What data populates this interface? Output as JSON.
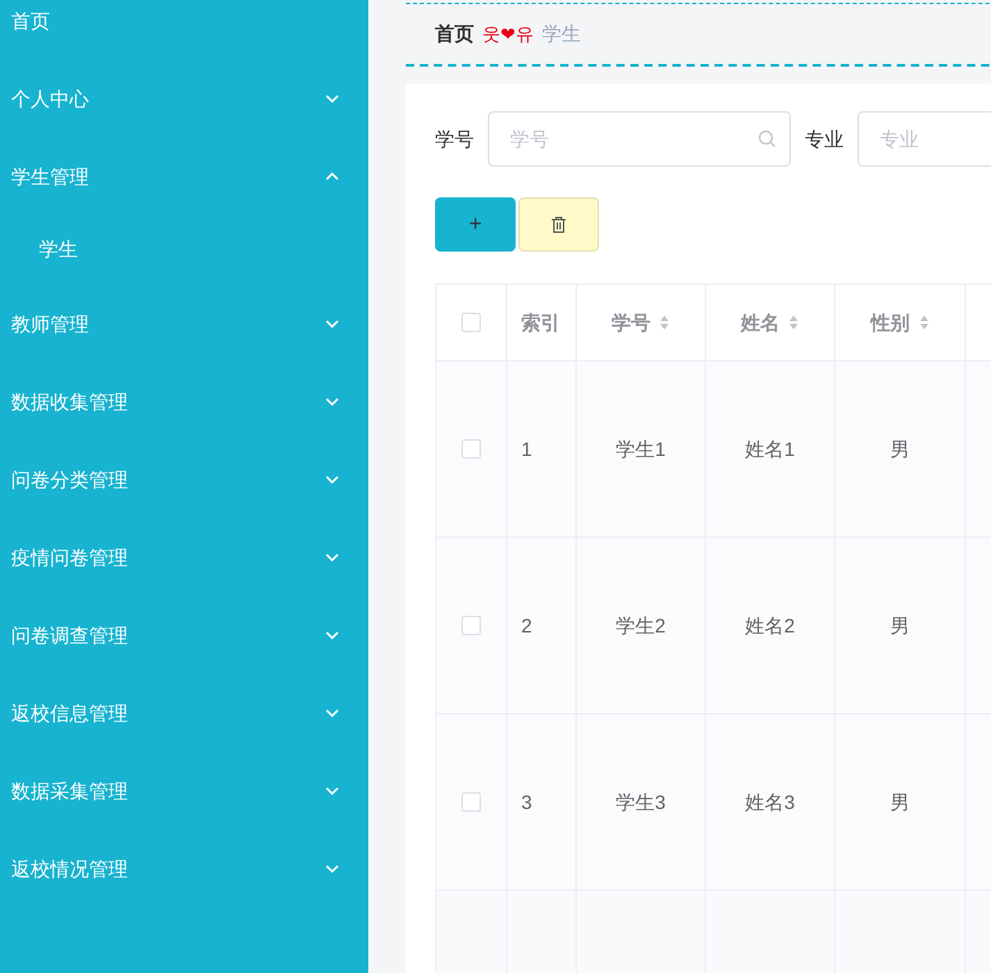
{
  "sidebar": {
    "items": [
      {
        "label": "首页",
        "has_children": false
      },
      {
        "label": "个人中心",
        "has_children": true,
        "expanded": false
      },
      {
        "label": "学生管理",
        "has_children": true,
        "expanded": true,
        "children": [
          {
            "label": "学生"
          }
        ]
      },
      {
        "label": "教师管理",
        "has_children": true,
        "expanded": false
      },
      {
        "label": "数据收集管理",
        "has_children": true,
        "expanded": false
      },
      {
        "label": "问卷分类管理",
        "has_children": true,
        "expanded": false
      },
      {
        "label": "疫情问卷管理",
        "has_children": true,
        "expanded": false
      },
      {
        "label": "问卷调查管理",
        "has_children": true,
        "expanded": false
      },
      {
        "label": "返校信息管理",
        "has_children": true,
        "expanded": false
      },
      {
        "label": "数据采集管理",
        "has_children": true,
        "expanded": false
      },
      {
        "label": "返校情况管理",
        "has_children": true,
        "expanded": false
      }
    ]
  },
  "breadcrumb": {
    "home": "首页",
    "separator": "웃❤유",
    "current": "学生"
  },
  "search": [
    {
      "label": "学号",
      "placeholder": "学号"
    },
    {
      "label": "专业",
      "placeholder": "专业"
    }
  ],
  "buttons": [
    {
      "kind": "add",
      "label": "+"
    },
    {
      "kind": "delete"
    }
  ],
  "table": {
    "all_checked": false,
    "columns": [
      {
        "label": "索引",
        "sortable": false
      },
      {
        "label": "学号",
        "sortable": true
      },
      {
        "label": "姓名",
        "sortable": true
      },
      {
        "label": "性别",
        "sortable": true
      }
    ],
    "rows": [
      {
        "checked": false,
        "cells": [
          "1",
          "学生1",
          "姓名1",
          "男"
        ]
      },
      {
        "checked": false,
        "cells": [
          "2",
          "学生2",
          "姓名2",
          "男"
        ]
      },
      {
        "checked": false,
        "cells": [
          "3",
          "学生3",
          "姓名3",
          "男"
        ]
      }
    ]
  }
}
